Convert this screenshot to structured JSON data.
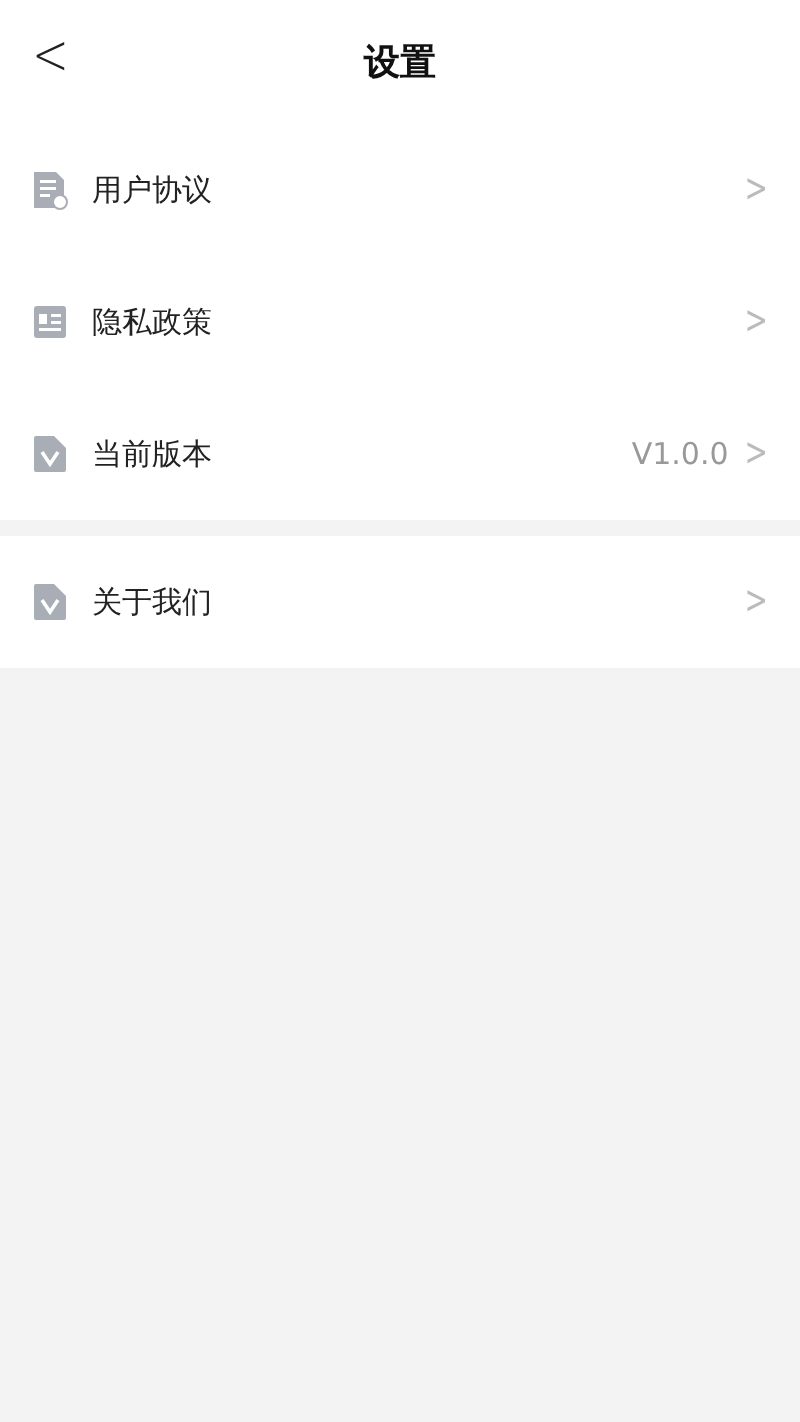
{
  "header": {
    "back": "<",
    "title": "设置"
  },
  "groups": [
    {
      "items": [
        {
          "kind": "document",
          "label": "用户协议",
          "chevron": ">"
        },
        {
          "kind": "card",
          "label": "隐私政策",
          "chevron": ">"
        },
        {
          "kind": "version",
          "label": "当前版本",
          "value": "V1.0.0",
          "chevron": ">"
        }
      ]
    },
    {
      "items": [
        {
          "kind": "version",
          "label": "关于我们",
          "chevron": ">"
        }
      ]
    }
  ]
}
